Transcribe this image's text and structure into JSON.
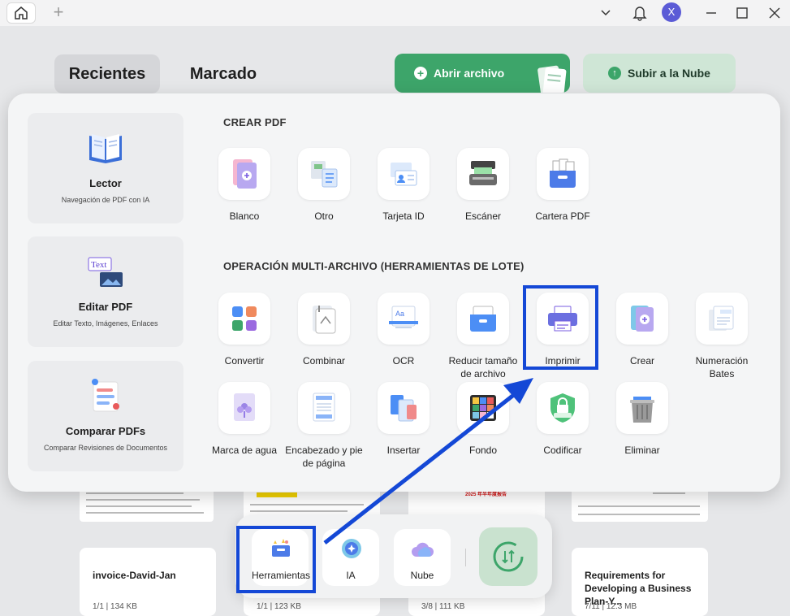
{
  "titlebar": {
    "avatar_initial": "X"
  },
  "home": {
    "tabs": [
      "Recientes",
      "Marcado"
    ],
    "open_button": "Abrir archivo",
    "cloud_button": "Subir a la Nube",
    "thumb_headline": "2025 年半年度报告",
    "files": [
      {
        "name": "invoice-David-Jan",
        "meta": "1/1 | 134 KB"
      },
      {
        "name": "",
        "meta": "1/1 | 123 KB"
      },
      {
        "name": "",
        "meta": "3/8 | 111 KB"
      },
      {
        "name": "Requirements for Developing a Business Plan-Y...",
        "meta": "7/11 | 12.3 MB"
      }
    ]
  },
  "side": [
    {
      "title": "Lector",
      "sub": "Navegación de PDF con IA"
    },
    {
      "title": "Editar PDF",
      "sub": "Editar Texto, Imágenes, Enlaces",
      "icon_text": "Text"
    },
    {
      "title": "Comparar PDFs",
      "sub": "Comparar Revisiones de Documentos"
    }
  ],
  "create_section": {
    "title": "CREAR PDF",
    "tools": [
      "Blanco",
      "Otro",
      "Tarjeta ID",
      "Escáner",
      "Cartera PDF"
    ]
  },
  "batch_section": {
    "title": "OPERACIÓN MULTI-ARCHIVO (HERRAMIENTAS DE LOTE)",
    "tools": [
      "Convertir",
      "Combinar",
      "OCR",
      "Reducir tamaño de archivo",
      "Imprimir",
      "Crear",
      "Numeración Bates",
      "Marca de agua",
      "Encabezado y pie de página",
      "Insertar",
      "Fondo",
      "Codificar",
      "Eliminar"
    ]
  },
  "dock": [
    "Herramientas",
    "IA",
    "Nube"
  ],
  "colors": {
    "accent_green": "#3da56a",
    "highlight_blue": "#1448d6"
  }
}
